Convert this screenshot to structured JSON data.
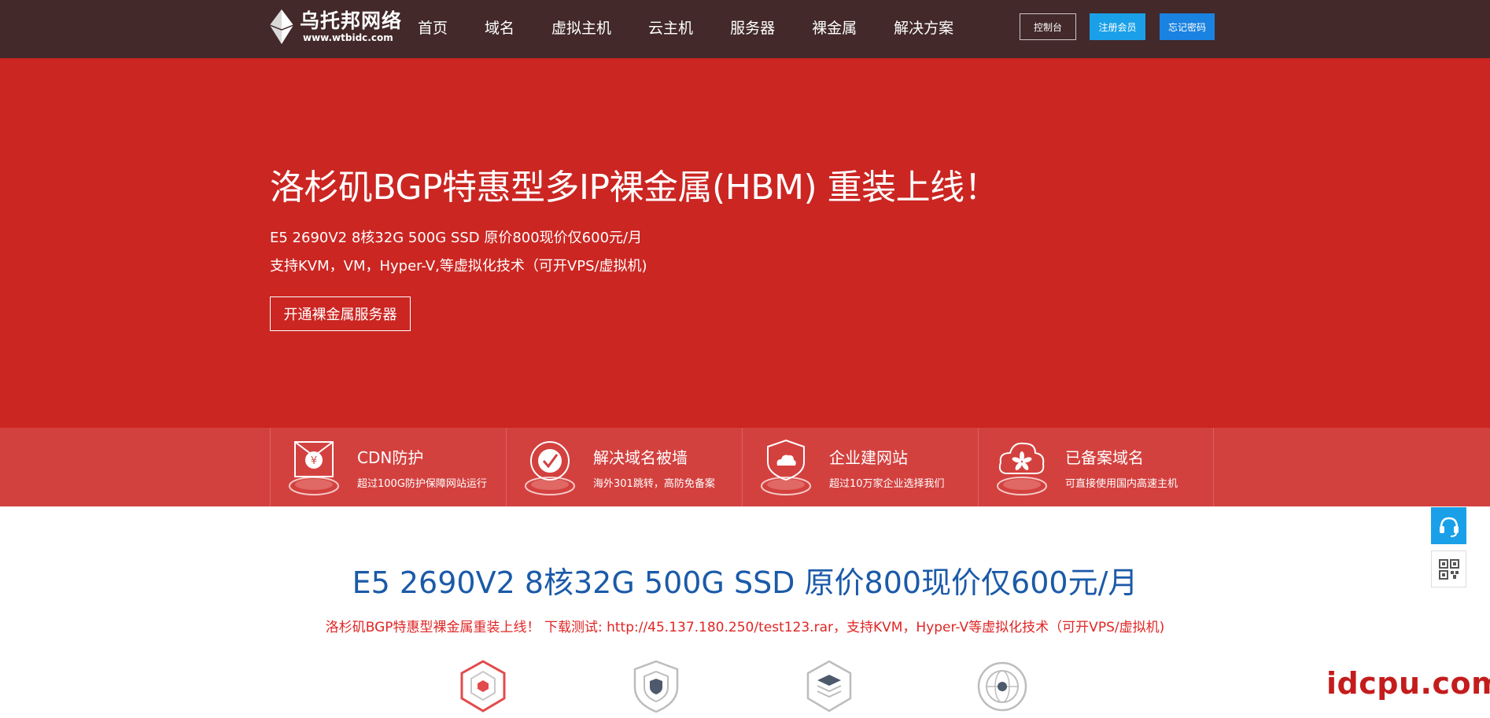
{
  "header": {
    "logo": {
      "name": "乌托邦网络",
      "url": "www.wtbidc.com"
    },
    "nav": [
      "首页",
      "域名",
      "虚拟主机",
      "云主机",
      "服务器",
      "裸金属",
      "解决方案"
    ],
    "buttons": {
      "console": "控制台",
      "register": "注册会员",
      "forgot": "忘记密码"
    }
  },
  "hero": {
    "title": "洛杉矶BGP特惠型多IP裸金属(HBM) 重装上线！",
    "line1": "E5 2690V2 8核32G 500G SSD 原价800现价仅600元/月",
    "line2": "支持KVM，VM，Hyper-V,等虚拟化技术（可开VPS/虚拟机)",
    "button": "开通裸金属服务器"
  },
  "features": [
    {
      "icon": "yuan-envelope-icon",
      "title": "CDN防护",
      "desc": "超过100G防护保障网站运行"
    },
    {
      "icon": "checkmark-icon",
      "title": "解决域名被墙",
      "desc": "海外301跳转，高防免备案"
    },
    {
      "icon": "cloud-shield-icon",
      "title": "企业建网站",
      "desc": "超过10万家企业选择我们"
    },
    {
      "icon": "bauhinia-cloud-icon",
      "title": "已备案域名",
      "desc": "可直接使用国内高速主机"
    }
  ],
  "main": {
    "title": "E5 2690V2 8核32G 500G SSD 原价800现价仅600元/月",
    "subtitle": "洛杉矶BGP特惠型裸金属重装上线！   下载测试: http://45.137.180.250/test123.rar，支持KVM，Hyper-V等虚拟化技术（可开VPS/虚拟机)"
  },
  "bottom_icons": [
    "hexagon-cube-icon",
    "shield-icon",
    "layers-icon",
    "globe-icon"
  ],
  "side": {
    "support_icon": "headset-icon",
    "qr_icon": "qr-code-icon"
  },
  "watermark": "idcpu.com",
  "colors": {
    "header_bg": "#43292a",
    "hero_bg": "#cb2622",
    "feature_bg": "#d3413f",
    "accent_blue": "#1aa0e8",
    "title_blue": "#1b5aa8",
    "subtitle_red": "#e02525"
  }
}
